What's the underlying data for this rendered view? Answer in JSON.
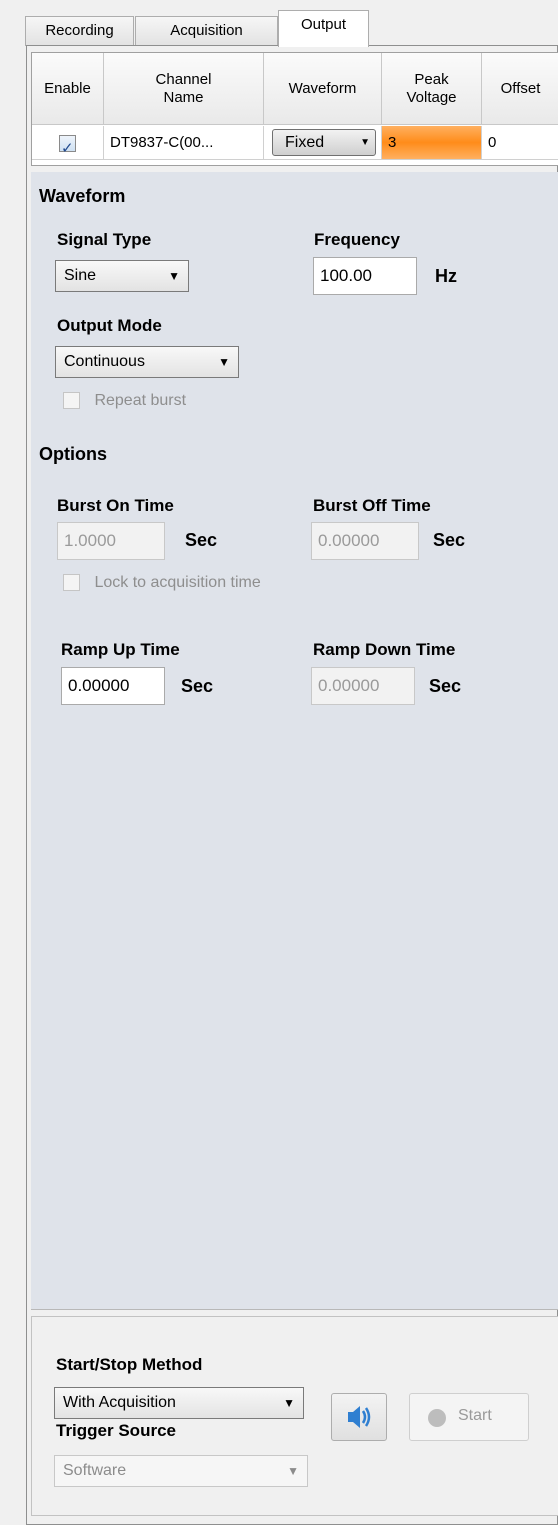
{
  "tabs": [
    {
      "label": "Recording"
    },
    {
      "label": "Acquisition"
    },
    {
      "label": "Output"
    }
  ],
  "grid": {
    "headers": [
      "Enable",
      "Channel\nName",
      "Waveform",
      "Peak\nVoltage",
      "Offset"
    ],
    "row": {
      "enabled": true,
      "channel_name": "DT9837-C(00...",
      "waveform": "Fixed",
      "peak_voltage": "3",
      "offset": "0"
    }
  },
  "waveform": {
    "title": "Waveform",
    "signal_type_label": "Signal Type",
    "signal_type_value": "Sine",
    "frequency_label": "Frequency",
    "frequency_value": "100.00",
    "frequency_unit": "Hz",
    "output_mode_label": "Output Mode",
    "output_mode_value": "Continuous",
    "repeat_burst_label": "Repeat burst"
  },
  "options": {
    "title": "Options",
    "burst_on_label": "Burst On Time",
    "burst_on_value": "1.0000",
    "burst_off_label": "Burst Off Time",
    "burst_off_value": "0.00000",
    "unit_sec": "Sec",
    "lock_label": "Lock to acquisition time",
    "ramp_up_label": "Ramp Up Time",
    "ramp_up_value": "0.00000",
    "ramp_down_label": "Ramp Down Time",
    "ramp_down_value": "0.00000"
  },
  "bottom": {
    "start_stop_label": "Start/Stop Method",
    "start_stop_value": "With Acquisition",
    "trigger_label": "Trigger Source",
    "trigger_value": "Software",
    "start_label": "Start"
  },
  "colors": {
    "peak_highlight": "#ff8c1a",
    "section_bg": "#dfe3ea",
    "speaker_blue": "#2f7fd1"
  }
}
